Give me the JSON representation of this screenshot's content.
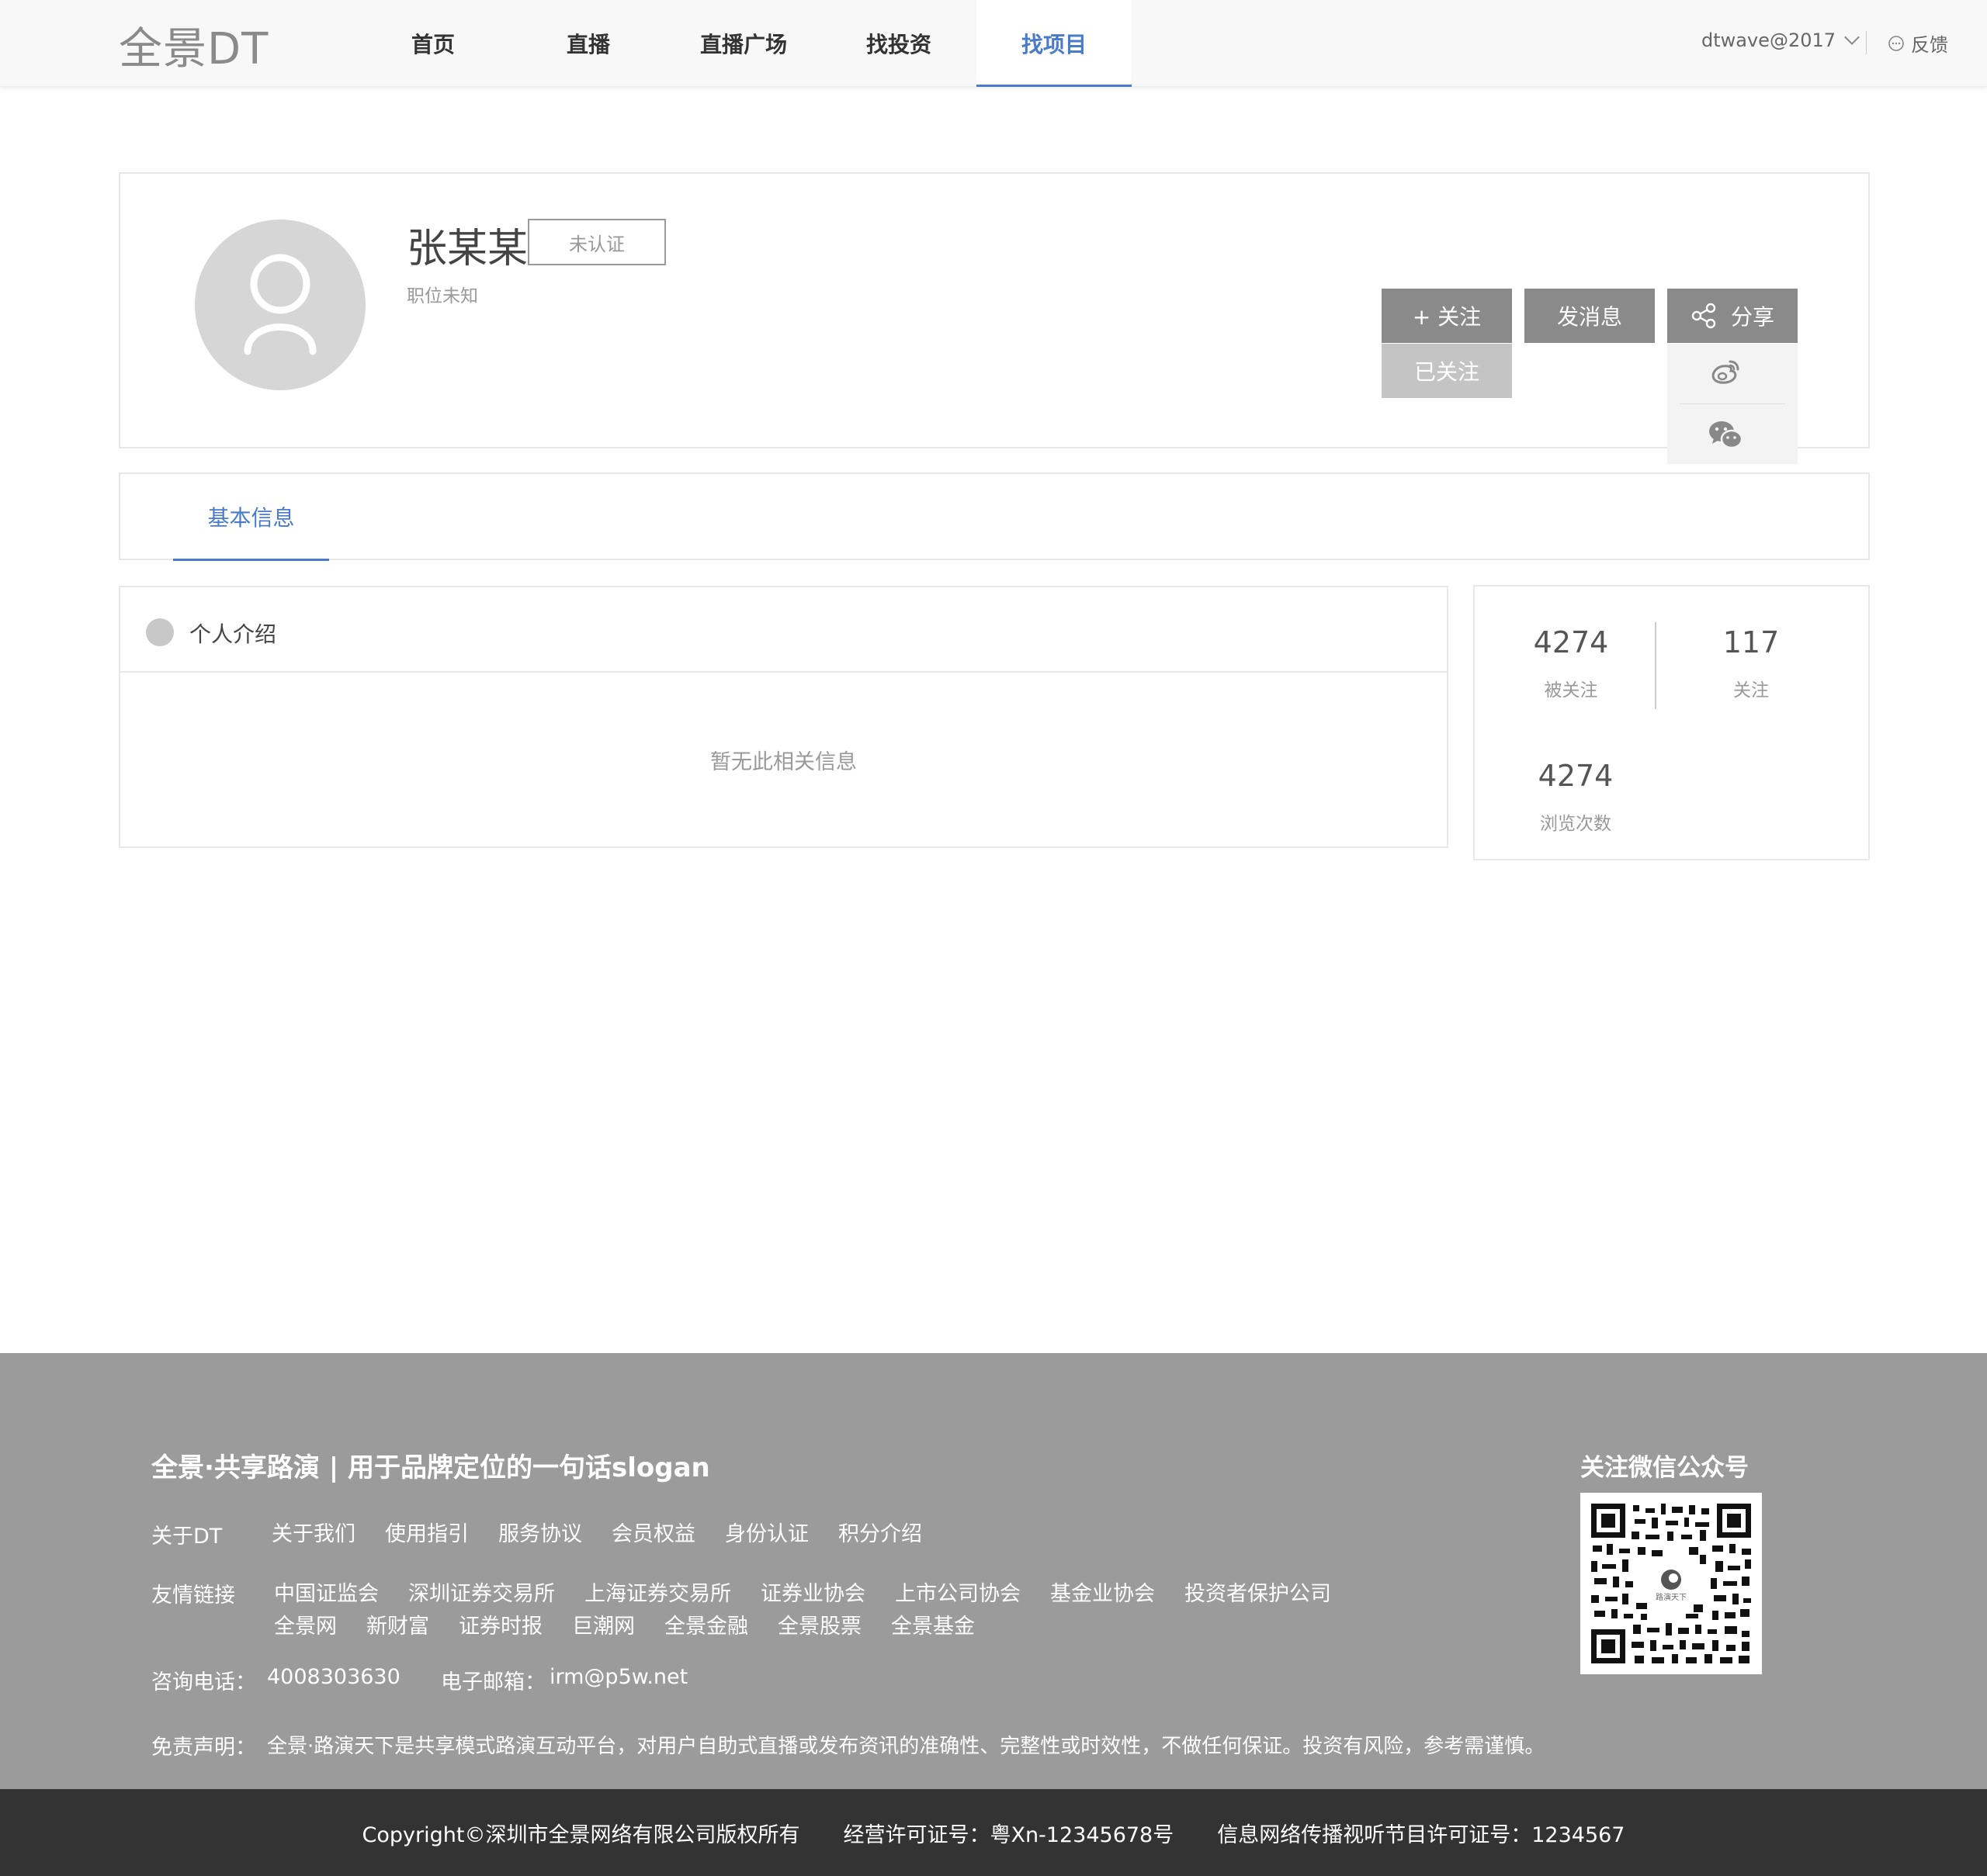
{
  "header": {
    "logo": "全景DT",
    "nav": [
      "首页",
      "直播",
      "直播广场",
      "找投资",
      "找项目"
    ],
    "active_nav": "找项目",
    "user": "dtwave@2017",
    "feedback": "反馈",
    "accent_color": "#4a7bc8"
  },
  "profile": {
    "name": "张某某",
    "badge": "未认证",
    "position": "职位未知",
    "follow_button": "+ 关注",
    "followed_button": "已关注",
    "message_button": "发消息",
    "share_button": "分享",
    "share_options": [
      "weibo-icon",
      "wechat-icon"
    ]
  },
  "tabs": [
    "基本信息"
  ],
  "intro": {
    "title": "个人介绍",
    "empty_text": "暂无此相关信息"
  },
  "stats": {
    "followers_count": "4274",
    "followers_label": "被关注",
    "following_count": "117",
    "following_label": "关注",
    "views_count": "4274",
    "views_label": "浏览次数"
  },
  "footer": {
    "slogan": "全景·共享路演 | 用于品牌定位的一句话slogan",
    "about_label": "关于DT",
    "about_links": [
      "关于我们",
      "使用指引",
      "服务协议",
      "会员权益",
      "身份认证",
      "积分介绍"
    ],
    "friend_label": "友情链接",
    "friend_links_row1": [
      "中国证监会",
      "深圳证券交易所",
      "上海证券交易所",
      "证券业协会",
      "上市公司协会",
      "基金业协会",
      "投资者保护公司"
    ],
    "friend_links_row2": [
      "全景网",
      "新财富",
      "证券时报",
      "巨潮网",
      "全景金融",
      "全景股票",
      "全景基金"
    ],
    "phone_label": "咨询电话：",
    "phone": "4008303630",
    "email_label": "电子邮箱：",
    "email": "irm@p5w.net",
    "disclaimer_label": "免责声明：",
    "disclaimer": "全景·路演天下是共享模式路演互动平台，对用户自助式直播或发布资讯的准确性、完整性或时效性，不做任何保证。投资有风险，参考需谨慎。",
    "qr_title": "关注微信公众号",
    "qr_logo_text": "路演天下"
  },
  "bottom_bar": {
    "copyright": "Copyright©深圳市全景网络有限公司版权所有",
    "license": "经营许可证号：粤Xn-12345678号",
    "av_license": "信息网络传播视听节目许可证号：1234567"
  }
}
